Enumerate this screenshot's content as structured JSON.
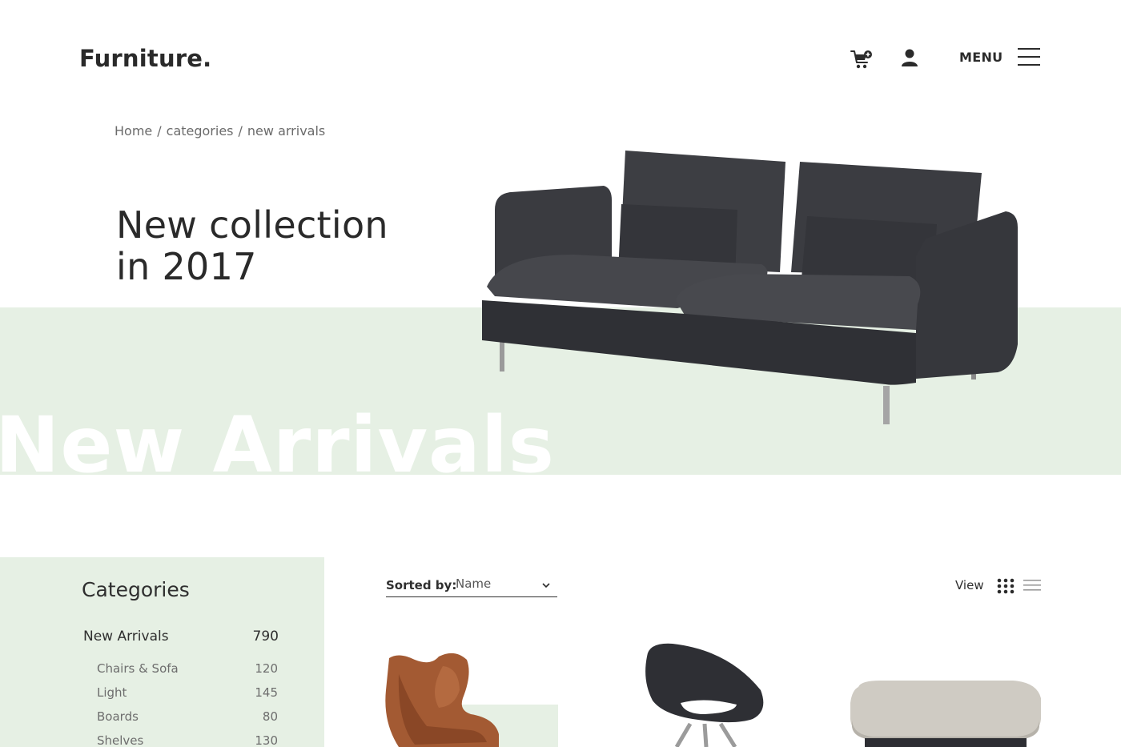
{
  "header": {
    "logo": "Furniture.",
    "menu_label": "MENU"
  },
  "breadcrumb": {
    "items": [
      "Home",
      "categories",
      "new arrivals"
    ],
    "separator": "/"
  },
  "hero": {
    "title_line1": "New collection",
    "title_line2": "in 2017",
    "banner_word": "New Arrivals"
  },
  "categories": {
    "title": "Categories",
    "main": {
      "label": "New Arrivals",
      "count": "790"
    },
    "items": [
      {
        "label": "Chairs & Sofa",
        "count": "120"
      },
      {
        "label": "Light",
        "count": "145"
      },
      {
        "label": "Boards",
        "count": "80"
      },
      {
        "label": "Shelves",
        "count": "130"
      }
    ]
  },
  "toolbar": {
    "sort_label": "Sorted by:",
    "sort_value": "Name",
    "view_label": "View"
  },
  "colors": {
    "accent_green": "#e6f0e4",
    "text_dark": "#2b2b2b",
    "text_muted": "#6b6b6b"
  }
}
